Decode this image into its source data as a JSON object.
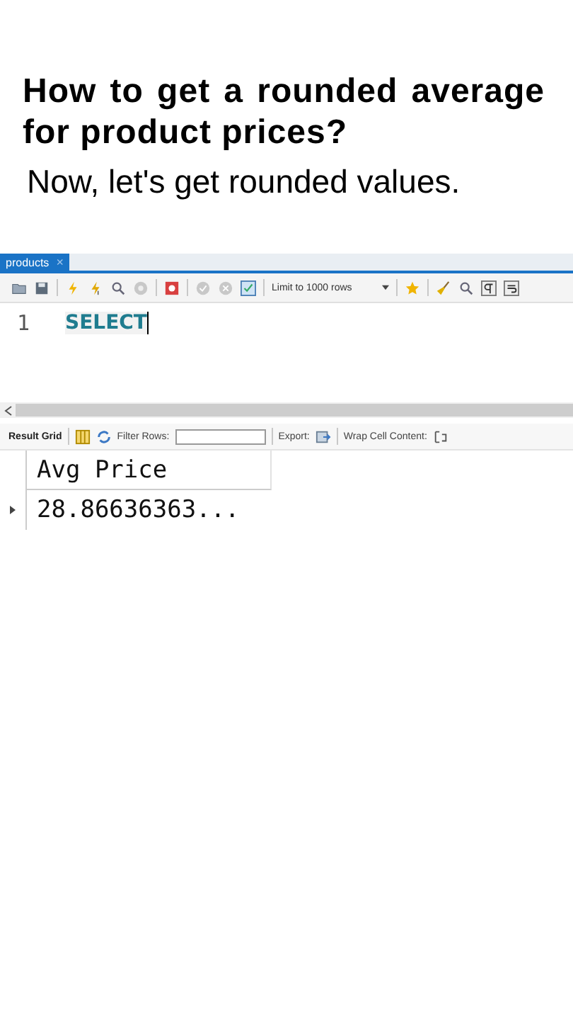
{
  "heading": "How to get a rounded average for product prices?",
  "subtitle": "Now, let's get rounded values.",
  "editor": {
    "tab": {
      "label": "products",
      "close": "×",
      "selected": true
    },
    "limit": "Limit to 1000 rows",
    "lines": [
      {
        "number": "1",
        "code": "SELECT"
      }
    ]
  },
  "results": {
    "result_grid": "Result Grid",
    "filter_label": "Filter Rows:",
    "export_label": "Export:",
    "wrap_label": "Wrap Cell Content:",
    "columns": [
      "Avg Price"
    ],
    "rows": [
      {
        "cells": [
          "28.86636363..."
        ],
        "current": true
      }
    ]
  }
}
